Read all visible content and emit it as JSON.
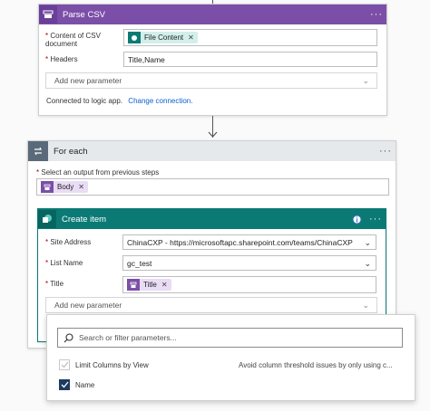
{
  "parse_csv": {
    "title": "Parse CSV",
    "content_label": "Content of CSV document",
    "content_token": "File Content",
    "headers_label": "Headers",
    "headers_value": "Title,Name",
    "add_param": "Add new parameter",
    "connected_text": "Connected to logic app.",
    "change_connection": "Change connection."
  },
  "for_each": {
    "title": "For each",
    "select_label": "Select an output from previous steps",
    "token": "Body"
  },
  "create_item": {
    "title": "Create item",
    "site_label": "Site Address",
    "site_value": "ChinaCXP - https://microsoftapc.sharepoint.com/teams/ChinaCXP",
    "list_label": "List Name",
    "list_value": "gc_test",
    "title_label": "Title",
    "title_token": "Title",
    "add_param": "Add new parameter"
  },
  "param_dropdown": {
    "search_placeholder": "Search or filter parameters...",
    "options": [
      {
        "label": "Limit Columns by View",
        "checked": false
      },
      {
        "label": "Name",
        "checked": true
      }
    ],
    "hint": "Avoid column threshold issues by only using c..."
  },
  "colors": {
    "csv_header": "#7b4fa8",
    "for_each_header": "#5a6a7a",
    "create_item_header": "#0b7a75",
    "token_purple_bg": "#e9dcf5",
    "token_teal_bg": "#d2efeb"
  }
}
